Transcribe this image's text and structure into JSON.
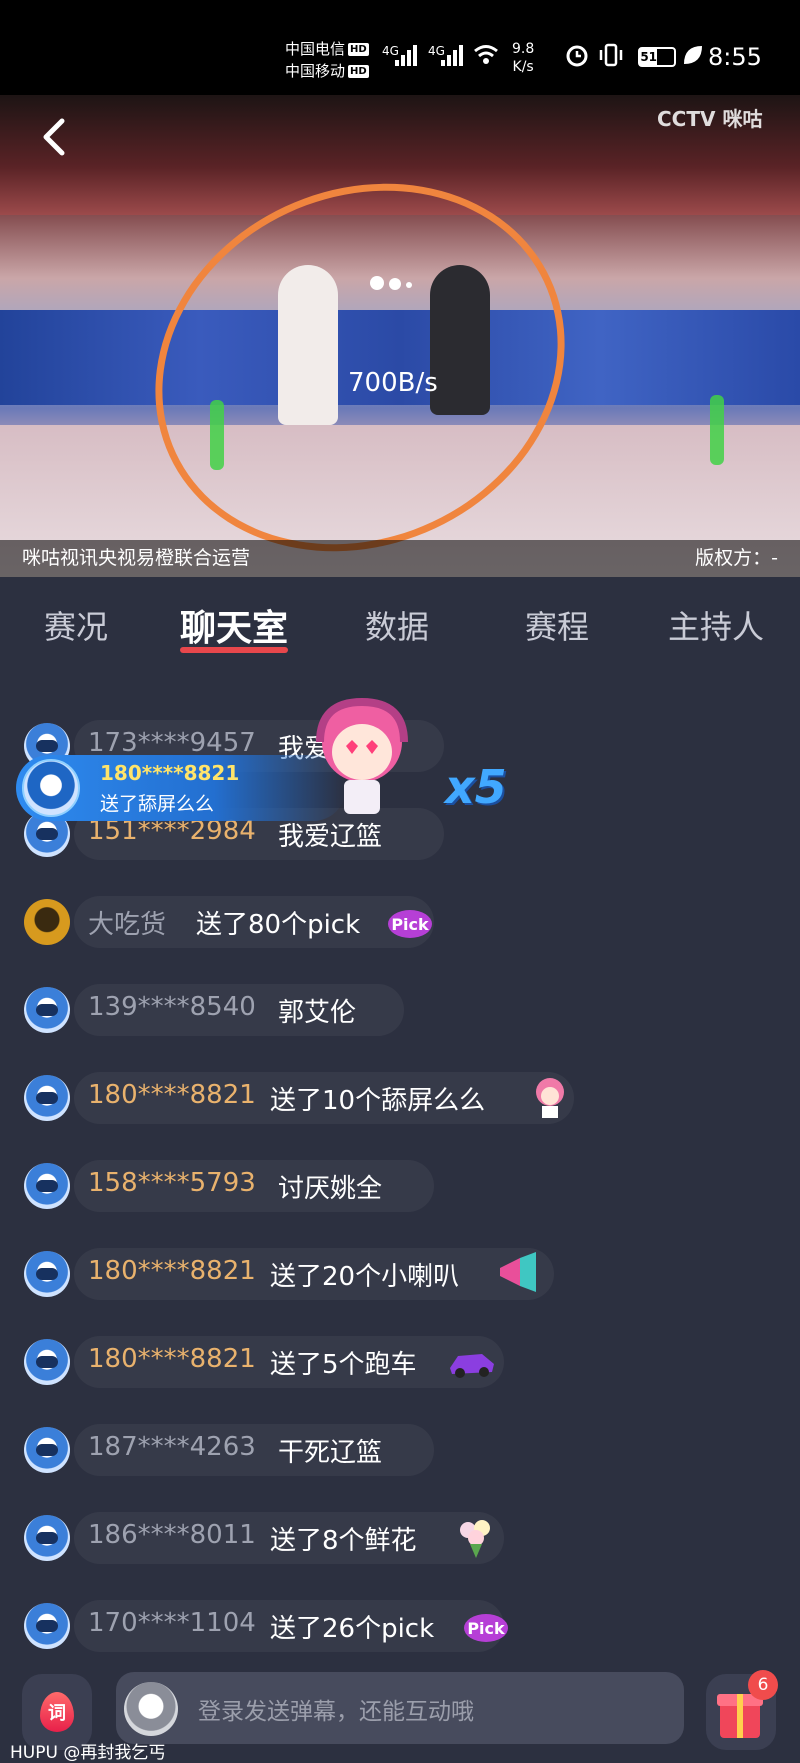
{
  "status_bar": {
    "carrier1": "中国电信",
    "carrier2": "中国移动",
    "hd": "HD",
    "network": "4G",
    "speed_value": "9.8",
    "speed_unit": "K/s",
    "battery": "51",
    "time": "8:55"
  },
  "video": {
    "watermark": "CCTV 咪咕",
    "net_speed": "700B/s",
    "caption_left": "咪咕视讯央视易橙联合运营",
    "caption_right": "版权方：-"
  },
  "tabs": [
    "赛况",
    "聊天室",
    "数据",
    "赛程",
    "主持人"
  ],
  "active_tab": "聊天室",
  "gift_banner": {
    "user": "180****8821",
    "message": "送了舔屏么么",
    "multiplier": "x5"
  },
  "chat": [
    {
      "user": "173****9457",
      "gold": false,
      "message": "我爱辽篮",
      "gift": null
    },
    {
      "user": "151****2984",
      "gold": true,
      "message": "我爱辽篮",
      "gift": null
    },
    {
      "user": "大吃货",
      "gold": false,
      "message": "送了80个pick",
      "gift": "pick-gift-icon"
    },
    {
      "user": "139****8540",
      "gold": false,
      "message": "郭艾伦",
      "gift": null
    },
    {
      "user": "180****8821",
      "gold": true,
      "message": "送了10个舔屏么么",
      "gift": "lick-screen-gift-icon"
    },
    {
      "user": "158****5793",
      "gold": true,
      "message": "讨厌姚全",
      "gift": null
    },
    {
      "user": "180****8821",
      "gold": true,
      "message": "送了20个小喇叭",
      "gift": "trumpet-gift-icon"
    },
    {
      "user": "180****8821",
      "gold": true,
      "message": "送了5个跑车",
      "gift": "sports-car-gift-icon"
    },
    {
      "user": "187****4263",
      "gold": false,
      "message": "干死辽篮",
      "gift": null
    },
    {
      "user": "186****8011",
      "gold": false,
      "message": "送了8个鲜花",
      "gift": "flower-gift-icon"
    },
    {
      "user": "170****1104",
      "gold": false,
      "message": "送了26个pick",
      "gift": "pick-gift-icon"
    }
  ],
  "bottom": {
    "ci_label": "词",
    "placeholder": "登录发送弹幕，还能互动哦",
    "gift_count": "6"
  },
  "footer_watermark": "HUPU @再封我乞丐"
}
